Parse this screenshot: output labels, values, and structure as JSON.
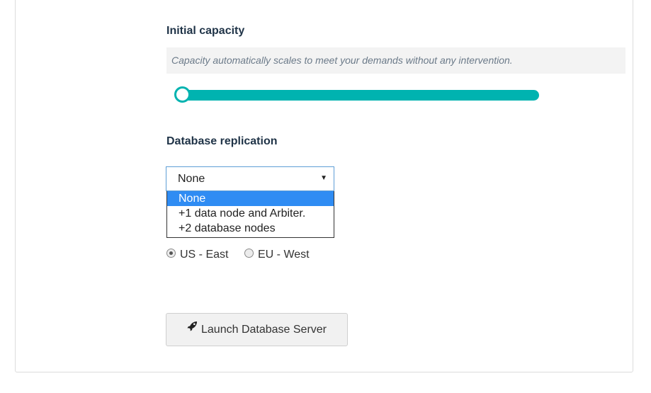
{
  "capacity": {
    "label": "Initial capacity",
    "help_text": "Capacity automatically scales to meet your demands without any intervention.",
    "slider_fraction": 0.0
  },
  "replication": {
    "label": "Database replication",
    "selected_value": "None",
    "options": [
      "None",
      "+1 data node and Arbiter.",
      "+2 database nodes"
    ]
  },
  "region": {
    "options": [
      {
        "label": "US - East",
        "checked": true
      },
      {
        "label": "EU - West",
        "checked": false
      }
    ]
  },
  "launch": {
    "label": "Launch Database Server",
    "icon": "rocket-icon"
  },
  "colors": {
    "accent": "#00b3b0",
    "heading": "#1f3347",
    "selected_option": "#2f8cf3"
  }
}
